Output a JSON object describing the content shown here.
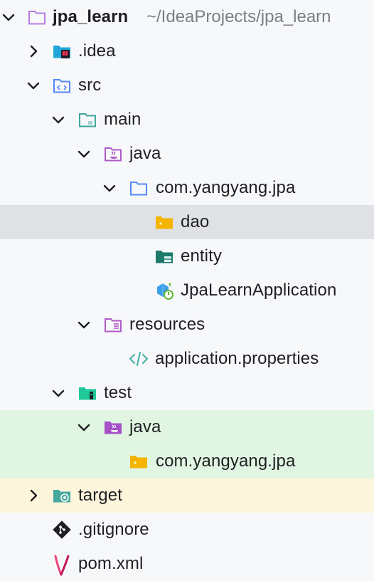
{
  "project": {
    "name": "jpa_learn",
    "path": "~/IdeaProjects/jpa_learn"
  },
  "nodes": {
    "idea": ".idea",
    "src": "src",
    "main": "main",
    "main_java": "java",
    "main_package": "com.yangyang.jpa",
    "dao": "dao",
    "entity": "entity",
    "app_class": "JpaLearnApplication",
    "resources": "resources",
    "app_properties": "application.properties",
    "test": "test",
    "test_java": "java",
    "test_package": "com.yangyang.jpa",
    "target": "target",
    "gitignore": ".gitignore",
    "pom": "pom.xml"
  },
  "icons": {
    "project": "module-folder-icon",
    "idea": "idea-folder-icon",
    "src": "source-folder-icon",
    "main": "folder-icon",
    "java": "java-source-root-icon",
    "package": "package-folder-icon",
    "dao": "package-folder-icon",
    "entity": "entity-package-icon",
    "app_class": "spring-boot-application-icon",
    "resources": "resources-root-icon",
    "properties": "properties-file-icon",
    "test": "test-folder-icon",
    "test_java": "test-source-root-icon",
    "target": "excluded-folder-icon",
    "gitignore": "git-icon",
    "pom": "maven-icon"
  },
  "colors": {
    "background": "#f7f8fa",
    "selected_row": "#dfe1e5",
    "test_source_row": "#e1f5e3",
    "excluded_row": "#fdf5dc",
    "path_text": "#7c7e85"
  }
}
